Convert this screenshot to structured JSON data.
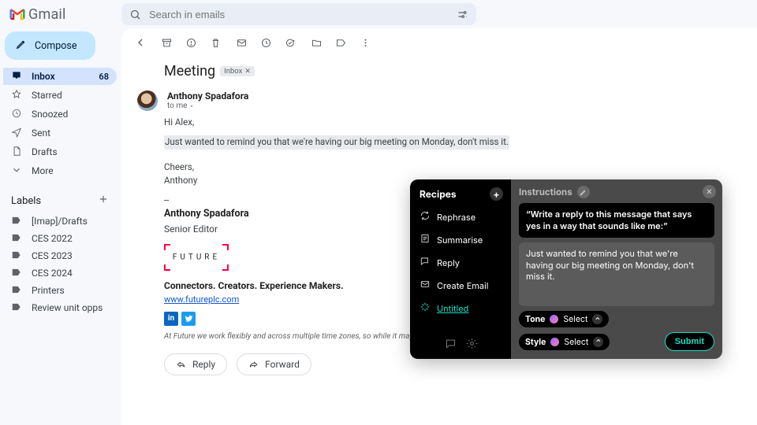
{
  "brand": {
    "name": "Gmail"
  },
  "search": {
    "placeholder": "Search in emails"
  },
  "compose": {
    "label": "Compose"
  },
  "nav": {
    "inbox": {
      "label": "Inbox",
      "count": "68"
    },
    "starred": {
      "label": "Starred"
    },
    "snoozed": {
      "label": "Snoozed"
    },
    "sent": {
      "label": "Sent"
    },
    "drafts": {
      "label": "Drafts"
    },
    "more": {
      "label": "More"
    }
  },
  "labels": {
    "header": "Labels",
    "items": [
      {
        "label": "[Imap]/Drafts"
      },
      {
        "label": "CES 2022"
      },
      {
        "label": "CES 2023"
      },
      {
        "label": "CES 2024"
      },
      {
        "label": "Printers"
      },
      {
        "label": "Review unit opps"
      }
    ]
  },
  "email": {
    "subject": "Meeting",
    "inbox_chip": "Inbox",
    "from": "Anthony Spadafora",
    "to_pre": "to me",
    "greeting": "Hi Alex,",
    "line1": "Just wanted to remind you that we're having our big meeting on Monday, don't miss it.",
    "close1": "Cheers,",
    "close2": "Anthony",
    "sep": "--",
    "sig_name": "Anthony Spadafora",
    "sig_title": "Senior Editor",
    "future_word": "FUTURE",
    "tagline": "Connectors. Creators. Experience Makers.",
    "url": "www.futureplc.com",
    "fineprint": "At Future we work flexibly and across multiple time zones, so while it may suit me to em",
    "reply": "Reply",
    "forward": "Forward"
  },
  "ai": {
    "recipes_title": "Recipes",
    "items": {
      "rephrase": "Rephrase",
      "summarise": "Summarise",
      "reply": "Reply",
      "create_email": "Create Email",
      "untitled": "Untitled"
    },
    "instructions_title": "Instructions",
    "prompt": "“Write a reply to this message that says yes in a way that sounds like me:”",
    "context": "Just wanted to remind you that we're having our big meeting on Monday, don't miss it.",
    "tone_label": "Tone",
    "style_label": "Style",
    "select": "Select",
    "submit": "Submit"
  }
}
